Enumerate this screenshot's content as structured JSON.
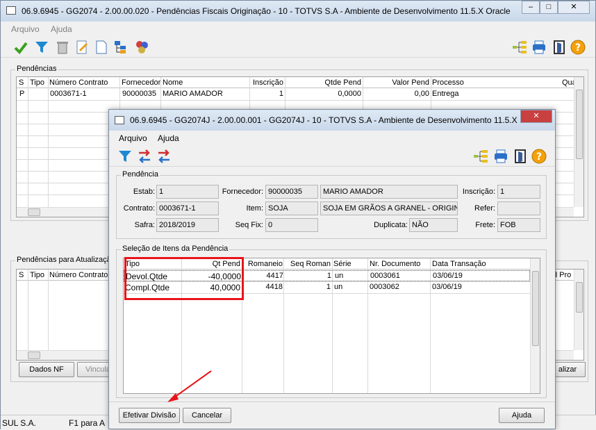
{
  "main": {
    "title": "06.9.6945 - GG2074 - 2.00.00.020 - Pendências Fiscais Originação - 10 - TOTVS S.A - Ambiente de Desenvolvimento 11.5.X Oracle",
    "menu": [
      "Arquivo",
      "Ajuda"
    ],
    "pendencias_label": "Pendências",
    "grid_headers": [
      "S",
      "Tipo",
      "Número Contrato",
      "Fornecedor",
      "Nome",
      "Inscrição",
      "Qtde Pend",
      "Valor Pend",
      "Processo",
      "Qua"
    ],
    "grid_rows": [
      [
        "P",
        "",
        "0003671-1",
        "90000035",
        "MARIO AMADOR",
        "1",
        "0,0000",
        "0,00",
        "Entrega"
      ]
    ],
    "atualizacao_label": "Pendências para Atualizaçã",
    "grid2_headers": [
      "S",
      "Tipo",
      "Número Contrato"
    ],
    "grid2_right_header": "d Pro",
    "dados_nf_label": "Dados NF",
    "vincula_label": "Vincula",
    "atualizar_label": "alizar",
    "status_left": "SUL S.A.",
    "status_mid": "F1 para A"
  },
  "dialog": {
    "title": "06.9.6945 - GG2074J - 2.00.00.001 - GG2074J - 10 - TOTVS S.A - Ambiente de Desenvolvimento 11.5.X ...",
    "menu": [
      "Arquivo",
      "Ajuda"
    ],
    "pendencia_label": "Pendência",
    "fields": {
      "estab_label": "Estab:",
      "estab": "1",
      "fornecedor_label": "Fornecedor:",
      "fornecedor_cod": "90000035",
      "fornecedor_nome": "MARIO AMADOR",
      "inscricao_label": "Inscrição:",
      "inscricao": "1",
      "contrato_label": "Contrato:",
      "contrato": "0003671-1",
      "item_label": "Item:",
      "item_cod": "SOJA",
      "item_desc": "SOJA EM GRÃOS A GRANEL - ORIGINAÇ",
      "refer_label": "Refer:",
      "refer": "",
      "safra_label": "Safra:",
      "safra": "2018/2019",
      "seqfix_label": "Seq Fix:",
      "seqfix": "0",
      "duplicata_label": "Duplicata:",
      "duplicata": "NÃO",
      "frete_label": "Frete:",
      "frete": "FOB"
    },
    "selecao_label": "Seleção de Itens da Pendência",
    "grid_headers": [
      "Tipo",
      "Qt Pend",
      "Romaneio",
      "Seq Roman",
      "Série",
      "Nr. Documento",
      "Data Transação"
    ],
    "grid_rows": [
      [
        "Devol.Qtde",
        "-40,0000",
        "4417",
        "1",
        "un",
        "0003061",
        "03/06/19"
      ],
      [
        "Compl.Qtde",
        "40,0000",
        "4418",
        "1",
        "un",
        "0003062",
        "03/06/19"
      ]
    ],
    "buttons": {
      "efetivar": "Efetivar Divisão",
      "cancelar": "Cancelar",
      "ajuda": "Ajuda"
    }
  },
  "colors": {
    "highlight_red": "#e8141a",
    "title_bg": "#dfe9f5",
    "accent_orange": "#f4a10c"
  },
  "icons": [
    "check-icon",
    "filter-icon",
    "trash-icon",
    "edit-icon",
    "new-document-icon",
    "tree-icon",
    "circles-icon",
    "hierarchy-icon",
    "print-icon",
    "exit-icon",
    "help-icon",
    "swap-icon"
  ]
}
